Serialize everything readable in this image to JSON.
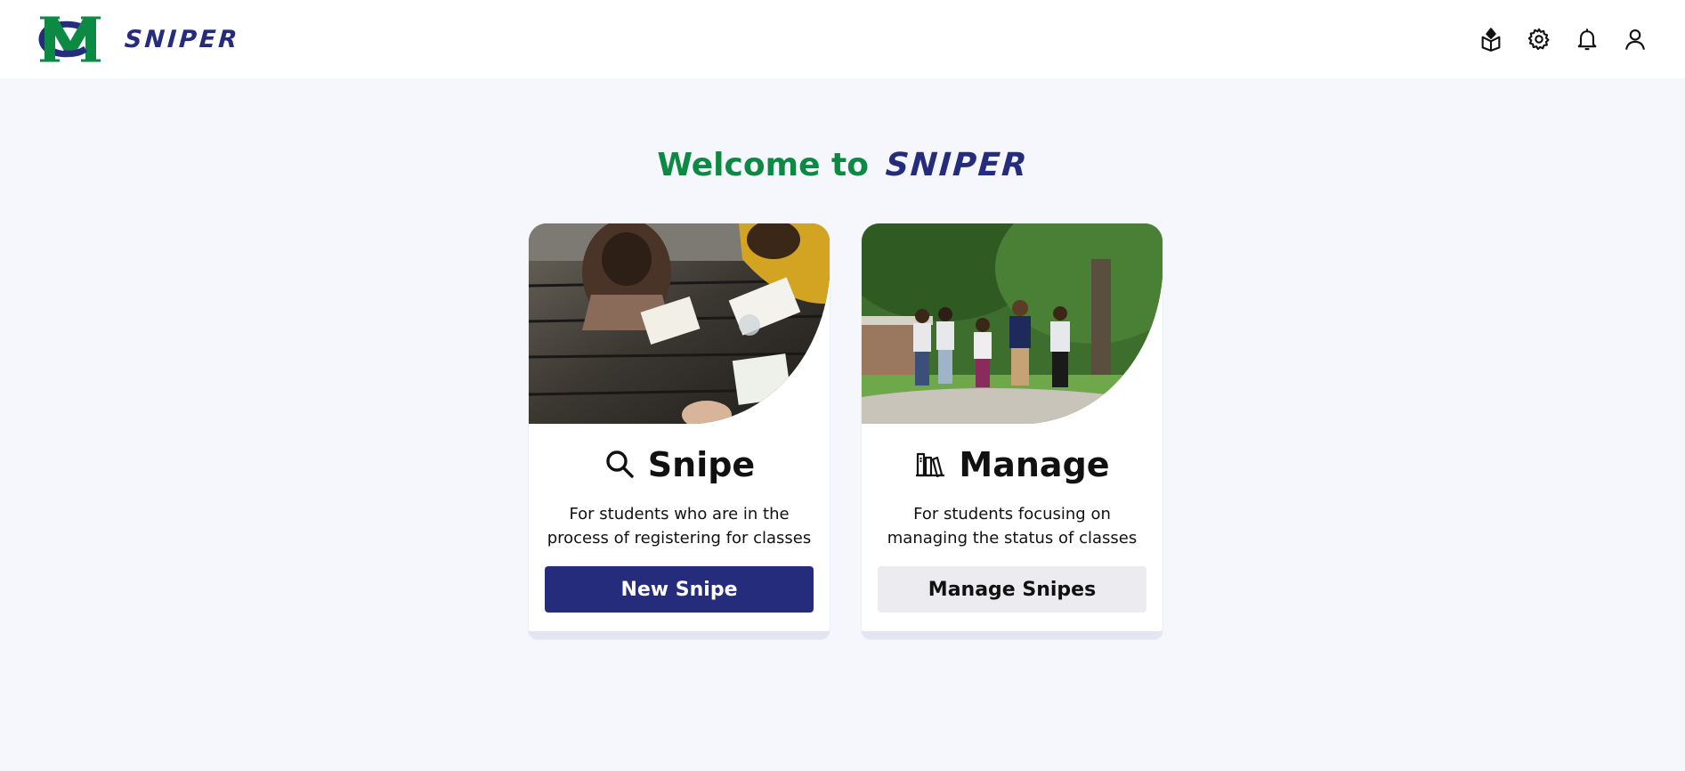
{
  "app": {
    "brand_name": "SNIPER",
    "colors": {
      "brand_green": "#0c8a44",
      "brand_navy": "#262c7c",
      "background": "#f6f7fc"
    }
  },
  "header": {
    "icons": [
      "study-icon",
      "gear-icon",
      "bell-icon",
      "user-icon"
    ]
  },
  "welcome": {
    "prefix": "Welcome to",
    "brand": "SNIPER"
  },
  "cards": [
    {
      "icon": "search-icon",
      "title": "Snipe",
      "description": "For students who are in the process of registering for classes",
      "button_label": "New Snipe"
    },
    {
      "icon": "books-icon",
      "title": "Manage",
      "description": "For students focusing on managing the status of classes",
      "button_label": "Manage Snipes"
    }
  ]
}
